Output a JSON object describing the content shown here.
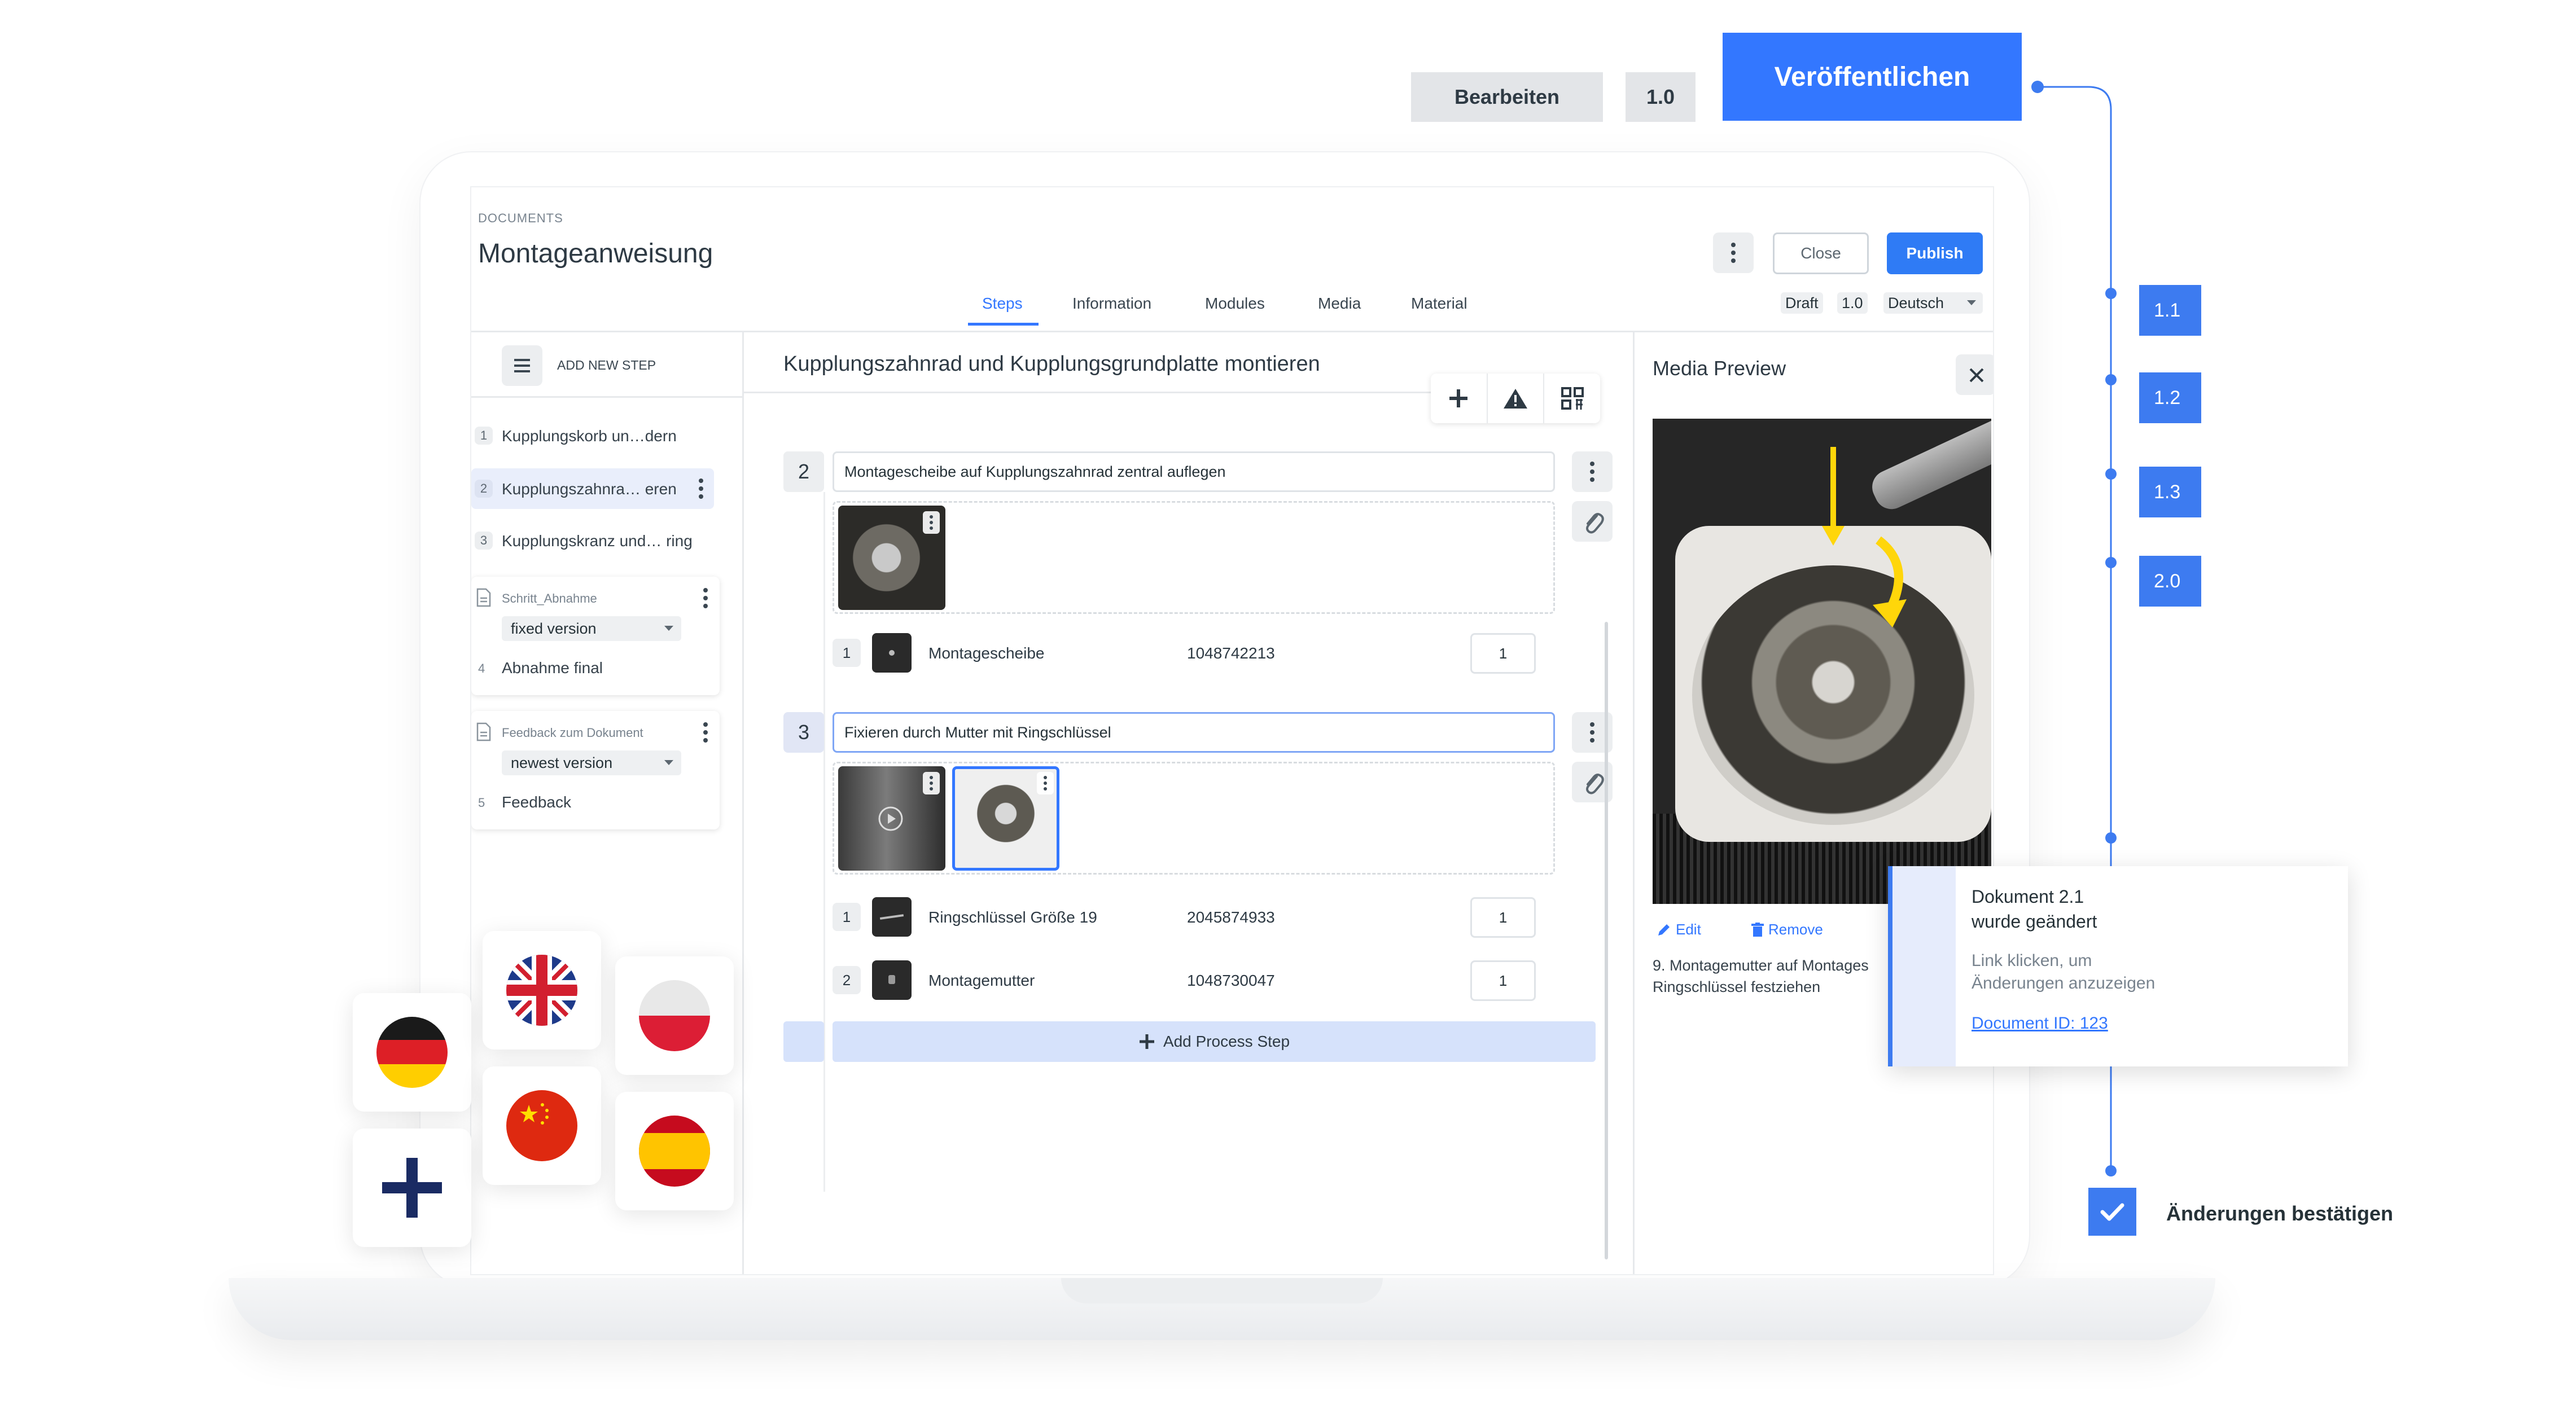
{
  "top_bar": {
    "edit_label": "Bearbeiten",
    "version_label": "1.0",
    "publish_big_label": "Veröffentlichen"
  },
  "header": {
    "breadcrumb": "DOCUMENTS",
    "title": "Montageanweisung",
    "close_label": "Close",
    "publish_label": "Publish"
  },
  "tabs": [
    "Steps",
    "Information",
    "Modules",
    "Media",
    "Material"
  ],
  "status": {
    "state": "Draft",
    "version": "1.0",
    "language": "Deutsch"
  },
  "sidebar": {
    "add_step_label": "ADD NEW STEP",
    "steps": [
      {
        "num": "1",
        "label": "Kupplungskorb un…dern"
      },
      {
        "num": "2",
        "label": "Kupplungszahnra… eren"
      },
      {
        "num": "3",
        "label": "Kupplungskranz und… ring"
      }
    ],
    "modules": [
      {
        "name": "Schritt_Abnahme",
        "version": "fixed version",
        "num": "4",
        "step": "Abnahme final"
      },
      {
        "name": "Feedback zum Dokument",
        "version": "newest version",
        "num": "5",
        "step": "Feedback"
      }
    ]
  },
  "editor": {
    "step_title": "Kupplungszahnrad und Kupplungsgrundplatte montieren",
    "process_steps": [
      {
        "num": "2",
        "text": "Montagescheibe auf Kupplungszahnrad zentral auflegen",
        "materials": [
          {
            "num": "1",
            "name": "Montagescheibe",
            "code": "1048742213",
            "qty": "1"
          }
        ]
      },
      {
        "num": "3",
        "text": "Fixieren durch Mutter mit Ringschlüssel",
        "materials": [
          {
            "num": "1",
            "name": "Ringschlüssel Größe 19",
            "code": "2045874933",
            "qty": "1"
          },
          {
            "num": "2",
            "name": "Montagemutter",
            "code": "1048730047",
            "qty": "1"
          }
        ]
      }
    ],
    "add_process_label": "Add Process Step"
  },
  "media_preview": {
    "title": "Media Preview",
    "edit_label": "Edit",
    "remove_label": "Remove",
    "caption_line1": "9. Montagemutter auf Montages",
    "caption_line2": "Ringschlüssel festziehen"
  },
  "notification": {
    "title_line1": "Dokument 2.1",
    "title_line2": "wurde geändert",
    "hint_line1": "Link klicken, um",
    "hint_line2": "Änderungen anzuzeigen",
    "link": "Document ID: 123"
  },
  "versions": [
    "1.1",
    "1.2",
    "1.3",
    "2.0"
  ],
  "confirm_label": "Änderungen bestätigen",
  "colors": {
    "accent": "#3377ff",
    "version_blue": "#3d7bf0",
    "publish_blue": "#2f7bf5"
  }
}
